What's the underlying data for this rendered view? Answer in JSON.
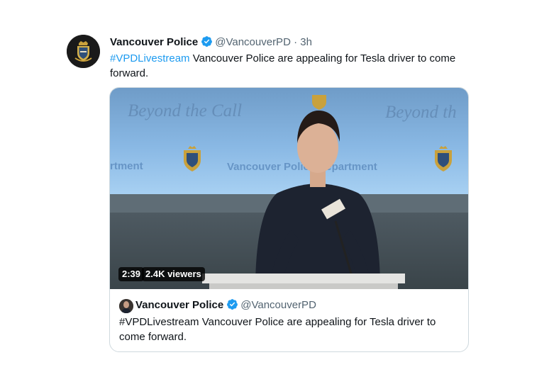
{
  "tweet": {
    "display_name": "Vancouver Police",
    "handle": "@VancouverPD",
    "separator": "·",
    "time": "3h",
    "hashtag": "#VPDLivestream",
    "text": " Vancouver Police are appealing for Tesla driver to come forward."
  },
  "video": {
    "backdrop_text_left": "Beyond the Call",
    "backdrop_text_right": "Beyond th",
    "backdrop_dept_left": "rtment",
    "backdrop_dept_center": "Vancouver Police Department",
    "duration": "2:39",
    "viewers": "2.4K viewers"
  },
  "quoted": {
    "display_name": "Vancouver Police",
    "handle": "@VancouverPD",
    "text": "#VPDLivestream Vancouver Police are appealing for Tesla driver to come forward."
  },
  "colors": {
    "link": "#1d9bf0",
    "verified": "#1d9bf0",
    "secondary_text": "#536471",
    "border": "#cfd9de"
  },
  "icons": {
    "verified": "verified-badge-icon",
    "crest": "police-crest-icon"
  }
}
